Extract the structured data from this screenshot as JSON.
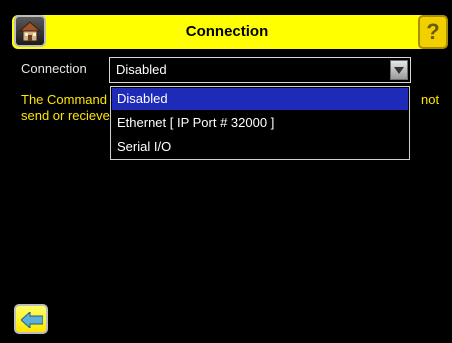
{
  "header": {
    "title": "Connection",
    "home_icon": "home-icon",
    "help_icon": "help-icon",
    "help_glyph": "?"
  },
  "form": {
    "connection_label": "Connection",
    "connection_value": "Disabled"
  },
  "info": {
    "line1_visible": "The Command",
    "line1_tail": "not",
    "line2_visible": "send or recieve"
  },
  "dropdown": {
    "options": [
      "Disabled",
      "Ethernet [ IP Port # 32000 ]",
      "Serial I/O"
    ],
    "selected": "Disabled"
  },
  "footer": {
    "back_icon": "back-arrow-icon"
  },
  "colors": {
    "background": "#000000",
    "titlebar": "#ffff00",
    "info_text": "#ffe600",
    "selection": "#1e2bb8"
  }
}
